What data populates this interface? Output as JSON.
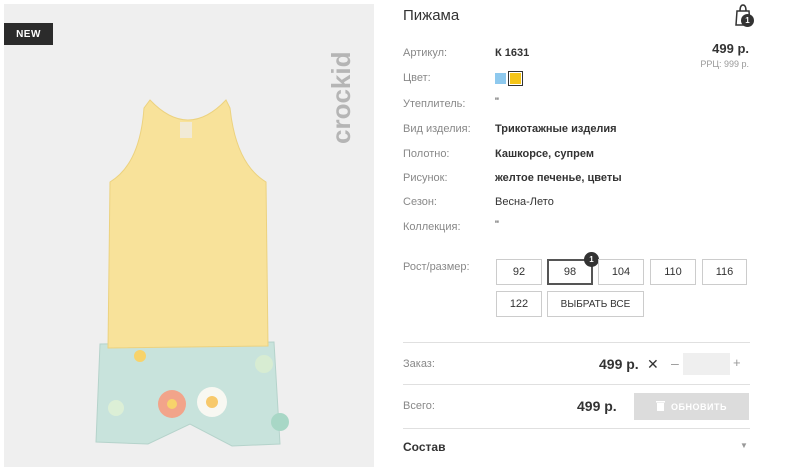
{
  "image": {
    "badge": "NEW",
    "brand": "crockid"
  },
  "product": {
    "title": "Пижама",
    "cart_count": "1",
    "price": "499 р.",
    "rrc": "РРЦ: 999 р.",
    "attributes": [
      {
        "label": "Артикул:",
        "value": "К 1631"
      },
      {
        "label": "Цвет:",
        "value": ""
      },
      {
        "label": "Утеплитель:",
        "value": "\""
      },
      {
        "label": "Вид изделия:",
        "value": "Трикотажные изделия"
      },
      {
        "label": "Полотно:",
        "value": "Кашкорсе, супрем"
      },
      {
        "label": "Рисунок:",
        "value": "желтое печенье, цветы"
      },
      {
        "label": "Сезон:",
        "value": "Весна-Лето"
      },
      {
        "label": "Коллекция:",
        "value": "\""
      }
    ],
    "colors": [
      "#8ec9ee",
      "#f5c518"
    ]
  },
  "sizes": {
    "label": "Рост/размер:",
    "options": [
      "92",
      "98",
      "104",
      "110",
      "116",
      "122"
    ],
    "selected": "98",
    "selected_count": "1",
    "select_all": "ВЫБРАТЬ ВСЕ"
  },
  "order": {
    "label": "Заказ:",
    "price": "499 р.",
    "remove": "✕",
    "minus": "–",
    "plus": "+",
    "quantity": ""
  },
  "total": {
    "label": "Всего:",
    "price": "499 р.",
    "button_label": "ОБНОВИТЬ"
  },
  "composition": {
    "label": "Состав"
  }
}
